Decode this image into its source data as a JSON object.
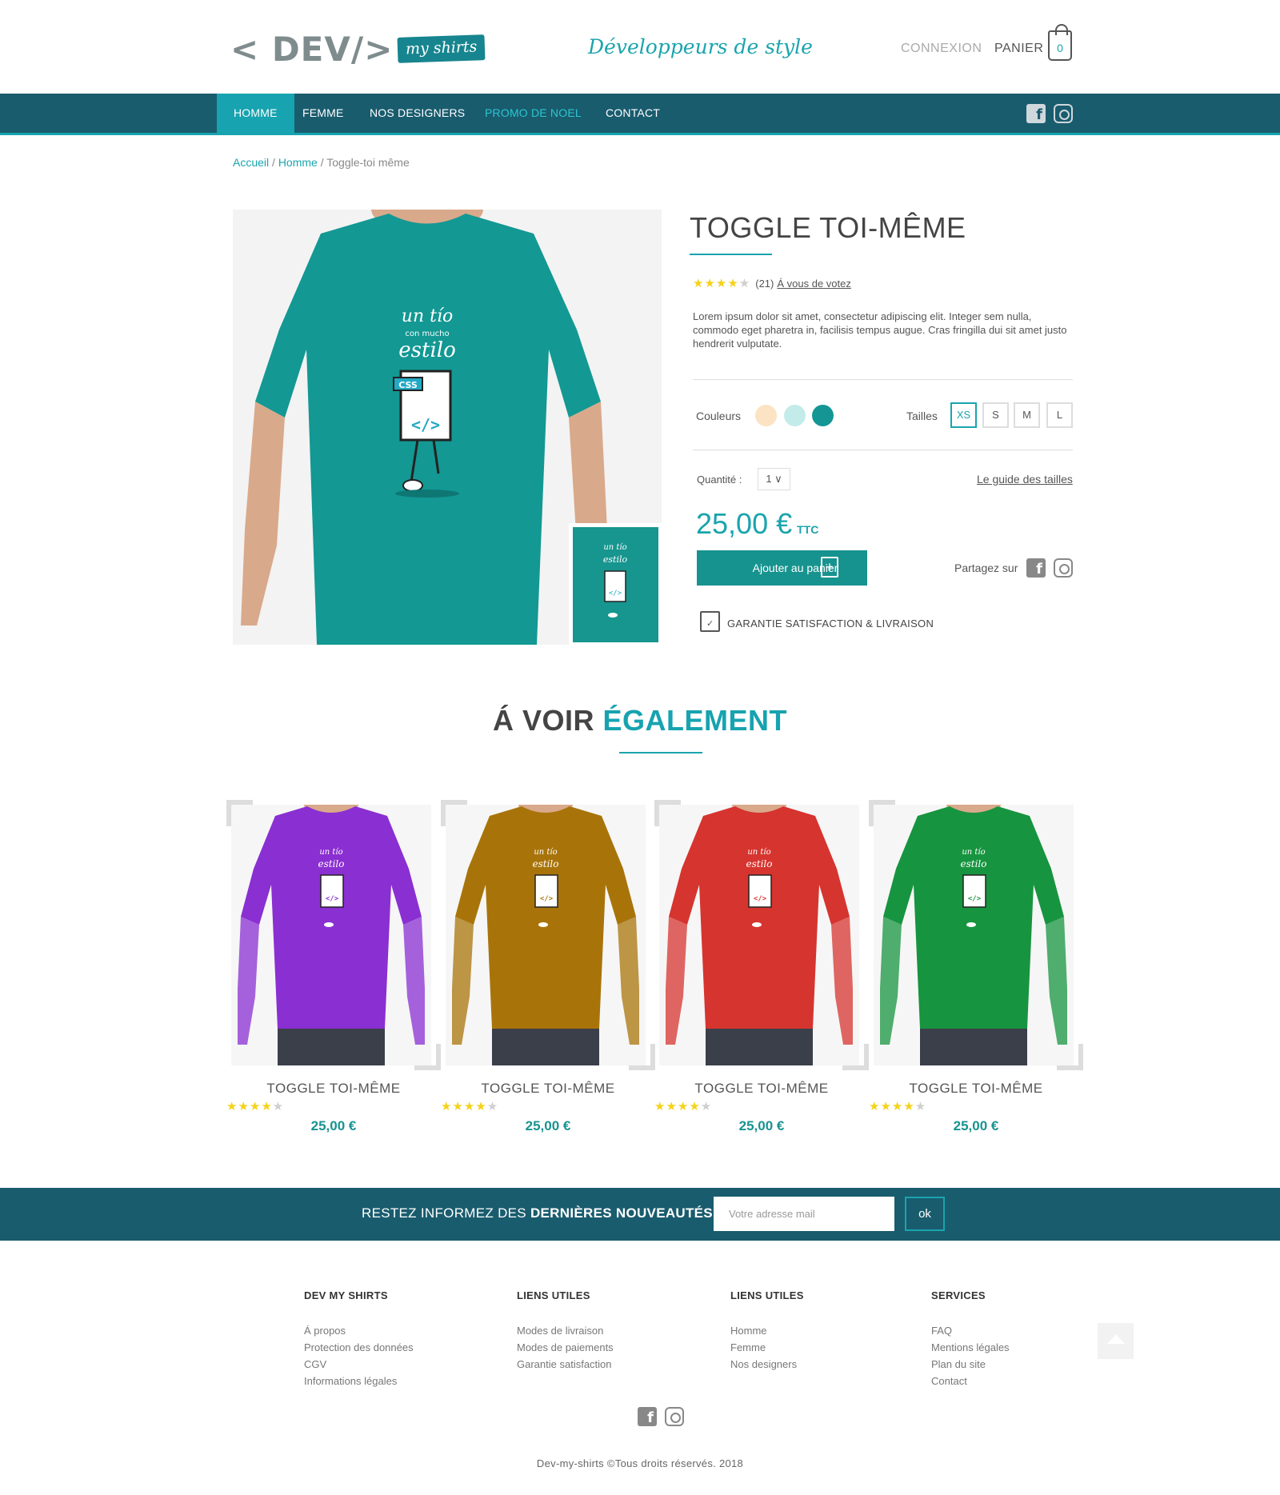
{
  "header": {
    "logo_text": "< DEV/>",
    "logo_badge": "my shirts",
    "tagline": "Développeurs de style",
    "login": "CONNEXION",
    "cart_label": "PANIER",
    "cart_count": "0"
  },
  "nav": {
    "items": [
      {
        "label": "HOMME",
        "active": true
      },
      {
        "label": "FEMME"
      },
      {
        "label": "NOS DESIGNERS"
      },
      {
        "label": "PROMO DE NOEL"
      },
      {
        "label": "CONTACT"
      }
    ],
    "social_icons": [
      "facebook-icon",
      "instagram-icon"
    ]
  },
  "breadcrumb": {
    "home": "Accueil",
    "category": "Homme",
    "current": "Toggle-toi même"
  },
  "product": {
    "title": "TOGGLE TOI-MÊME",
    "rating": 4,
    "rating_max": 5,
    "review_count": "(21)",
    "vote_link": "Á vous de votez",
    "description": "Lorem ipsum dolor sit amet, consectetur adipiscing elit. Integer sem nulla, commodo eget pharetra in, facilisis tempus augue. Cras fringilla dui sit amet justo hendrerit vulputate.",
    "colors_label": "Couleurs",
    "colors": [
      "#fbe3c4",
      "#c3ebea",
      "#149694"
    ],
    "sizes_label": "Tailles",
    "sizes": [
      "XS",
      "S",
      "M",
      "L"
    ],
    "selected_size": "XS",
    "quantity_label": "Quantité :",
    "quantity_value": "1",
    "size_guide": "Le guide des tailles",
    "price": "25,00 €",
    "price_suffix": "TTC",
    "add_to_cart": "Ajouter au panier",
    "share_label": "Partagez sur",
    "guarantee": "GARANTIE SATISFACTION & LIVRAISON",
    "shirt_color": "#139893"
  },
  "related": {
    "title_plain": "Á VOIR",
    "title_highlight": "ÉGALEMENT",
    "items": [
      {
        "title": "TOGGLE TOI-MÊME",
        "price": "25,00 €",
        "color": "#8a2fd1",
        "rating": 4
      },
      {
        "title": "TOGGLE TOI-MÊME",
        "price": "25,00 €",
        "color": "#a8740a",
        "rating": 4
      },
      {
        "title": "TOGGLE TOI-MÊME",
        "price": "25,00 €",
        "color": "#d6342f",
        "rating": 4
      },
      {
        "title": "TOGGLE TOI-MÊME",
        "price": "25,00 €",
        "color": "#17943f",
        "rating": 4
      }
    ]
  },
  "newsletter": {
    "text_plain": "RESTEZ INFORMEZ DES",
    "text_bold": "DERNIÈRES NOUVEAUTÉS",
    "placeholder": "Votre adresse mail",
    "button": "ok"
  },
  "footer": {
    "columns": [
      {
        "title": "DEV MY SHIRTS",
        "links": [
          "Á propos",
          "Protection des données",
          "CGV",
          "Informations légales"
        ]
      },
      {
        "title": "LIENS UTILES",
        "links": [
          "Modes de livraison",
          "Modes de paiements",
          "Garantie satisfaction"
        ]
      },
      {
        "title": "LIENS UTILES",
        "links": [
          "Homme",
          "Femme",
          "Nos designers"
        ]
      },
      {
        "title": "SERVICES",
        "links": [
          "FAQ",
          "Mentions légales",
          "Plan du site",
          "Contact"
        ]
      }
    ],
    "copyright_name": "Dev-my-shirts",
    "copyright_rest": "Tous droits réservés. 2018"
  },
  "colors": {
    "primary_dark": "#195c6e",
    "accent": "#17a3b0",
    "star": "#f5d21a"
  }
}
